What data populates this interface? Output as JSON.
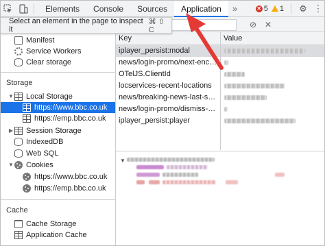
{
  "toolbar": {
    "tabs": [
      "Elements",
      "Console",
      "Sources",
      "Application"
    ],
    "active_tab": "Application",
    "more_icon": "double-chevron-right-icon",
    "error_count": "5",
    "warning_count": "1",
    "accent": "#1a73e8",
    "error_color": "#d93025",
    "warning_color": "#f9ab00"
  },
  "inspect_tooltip": {
    "text": "Select an element in the page to inspect it",
    "shortcut": "⌘ ⇧ C"
  },
  "sidebar": {
    "app_items": [
      {
        "label": "Manifest",
        "icon": "document-icon"
      },
      {
        "label": "Service Workers",
        "icon": "gear-icon"
      },
      {
        "label": "Clear storage",
        "icon": "database-icon"
      }
    ],
    "storage_heading": "Storage",
    "storage_items": [
      {
        "label": "Local Storage",
        "icon": "grid-icon",
        "expanded": true
      },
      {
        "label": "https://www.bbc.co.uk",
        "icon": "grid-icon",
        "selected": true
      },
      {
        "label": "https://emp.bbc.co.uk",
        "icon": "grid-icon"
      },
      {
        "label": "Session Storage",
        "icon": "grid-icon",
        "expanded": false
      },
      {
        "label": "IndexedDB",
        "icon": "database-icon"
      },
      {
        "label": "Web SQL",
        "icon": "database-icon"
      },
      {
        "label": "Cookies",
        "icon": "cookie-icon",
        "expanded": true
      },
      {
        "label": "https://www.bbc.co.uk",
        "icon": "cookie-icon"
      },
      {
        "label": "https://emp.bbc.co.uk",
        "icon": "cookie-icon"
      }
    ],
    "cache_heading": "Cache",
    "cache_items": [
      {
        "label": "Cache Storage",
        "icon": "database-icon"
      },
      {
        "label": "Application Cache",
        "icon": "grid-icon"
      }
    ],
    "selected_color": "#1a73e8"
  },
  "table": {
    "headers": [
      "Key",
      "Value"
    ],
    "rows": [
      {
        "key": "iplayer_persist:modal",
        "highlighted": true
      },
      {
        "key": "news/login-promo/next-enco..."
      },
      {
        "key": "OTelJS.ClientId"
      },
      {
        "key": "locservices-recent-locations"
      },
      {
        "key": "news/breaking-news-last-seen"
      },
      {
        "key": "news/login-promo/dismiss-co..."
      },
      {
        "key": "iplayer_persist:player"
      }
    ]
  },
  "annotation_color": "#e53935"
}
